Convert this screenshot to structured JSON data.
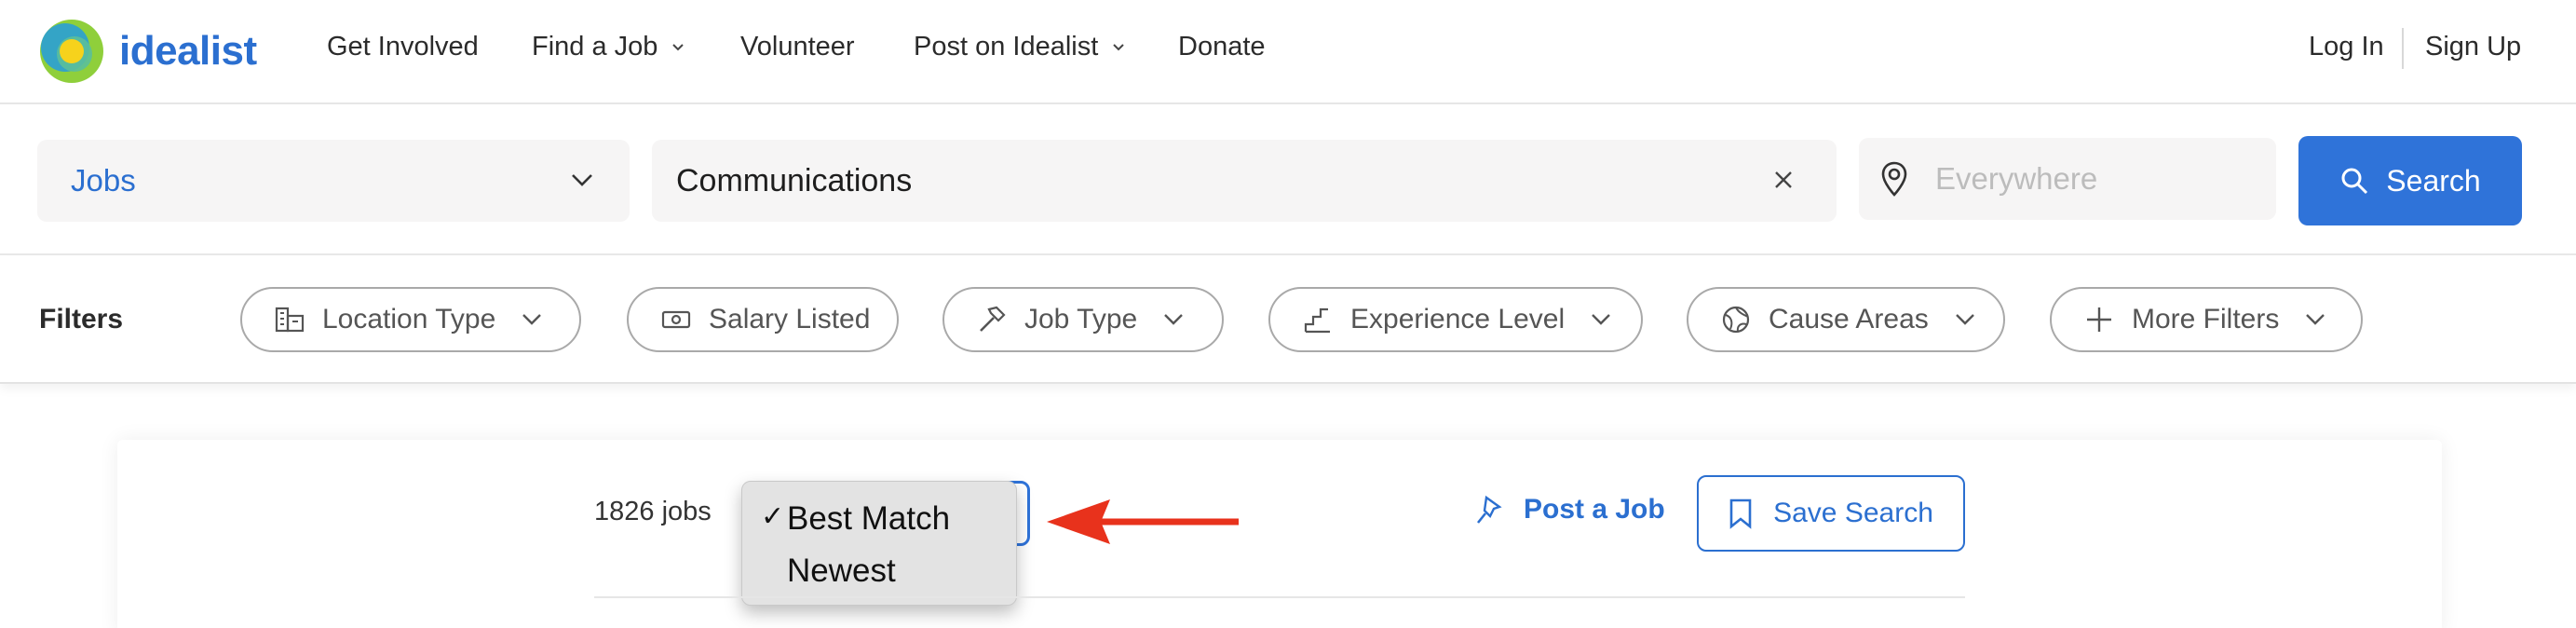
{
  "brand": {
    "name": "idealist"
  },
  "nav": {
    "items": [
      {
        "label": "Get Involved",
        "has_menu": false
      },
      {
        "label": "Find a Job",
        "has_menu": true
      },
      {
        "label": "Volunteer",
        "has_menu": false
      },
      {
        "label": "Post on Idealist",
        "has_menu": true
      },
      {
        "label": "Donate",
        "has_menu": false
      }
    ],
    "login": "Log In",
    "signup": "Sign Up"
  },
  "search": {
    "type_value": "Jobs",
    "query_value": "Communications",
    "location_placeholder": "Everywhere",
    "button_label": "Search"
  },
  "filters": {
    "label": "Filters",
    "chips": [
      {
        "label": "Location Type",
        "icon": "building-icon",
        "has_menu": true
      },
      {
        "label": "Salary Listed",
        "icon": "cash-icon",
        "has_menu": false
      },
      {
        "label": "Job Type",
        "icon": "hammer-icon",
        "has_menu": true
      },
      {
        "label": "Experience Level",
        "icon": "stairs-icon",
        "has_menu": true
      },
      {
        "label": "Cause Areas",
        "icon": "globe-icon",
        "has_menu": true
      },
      {
        "label": "More Filters",
        "icon": "plus-icon",
        "has_menu": true
      }
    ]
  },
  "results": {
    "count_label": "1826 jobs",
    "sort": {
      "selected": "Best Match",
      "options": [
        "Best Match",
        "Newest"
      ],
      "check": "✓"
    },
    "post_job_label": "Post a Job",
    "save_search_label": "Save Search"
  },
  "colors": {
    "brand_blue": "#2b6fd0",
    "button_blue": "#2f73d9",
    "annotation_arrow": "#e8321c"
  }
}
